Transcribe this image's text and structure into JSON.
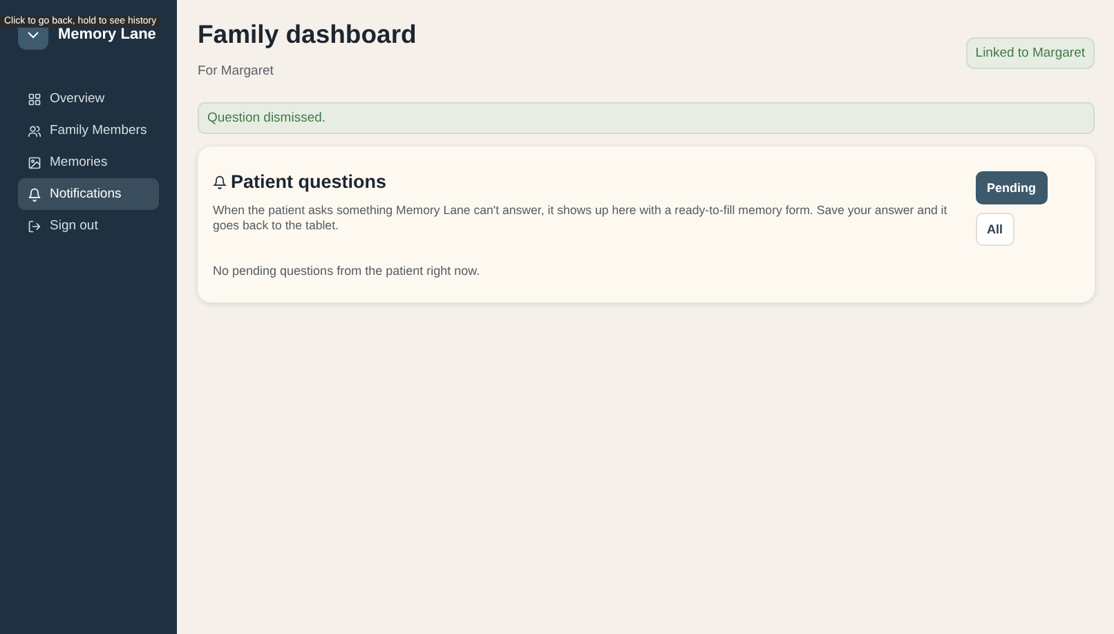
{
  "tooltip": "Click to go back, hold to see history",
  "brand": "Memory Lane",
  "sidebar": {
    "items": [
      {
        "label": "Overview",
        "selected": false
      },
      {
        "label": "Family Members",
        "selected": false
      },
      {
        "label": "Memories",
        "selected": false
      },
      {
        "label": "Notifications",
        "selected": true
      },
      {
        "label": "Sign out",
        "selected": false
      }
    ]
  },
  "header": {
    "title": "Family dashboard",
    "subtitle": "For Margaret",
    "badge": "Linked to Margaret"
  },
  "alert": "Question dismissed.",
  "card": {
    "title": "Patient questions",
    "description": "When the patient asks something Memory Lane can't answer, it shows up here with a ready-to-fill memory form. Save your answer and it goes back to the tablet.",
    "empty": "No pending questions from the patient right now.",
    "filters": [
      {
        "label": "Pending",
        "selected": true
      },
      {
        "label": "All",
        "selected": false
      }
    ]
  }
}
